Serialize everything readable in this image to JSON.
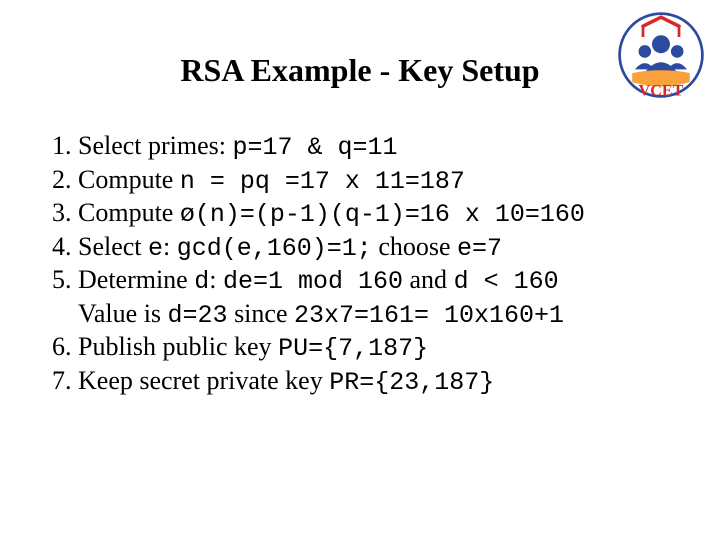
{
  "title": "RSA Example - Key Setup",
  "logo": {
    "name": "VCET",
    "colors": {
      "red": "#d62828",
      "blue": "#2b4aa0",
      "orange": "#f9a13a"
    }
  },
  "steps": [
    {
      "pre": "Select primes: ",
      "code": "p=17 & q=11"
    },
    {
      "pre": "Compute ",
      "code": "n = pq =17 x 11=187"
    },
    {
      "pre": "Compute ",
      "code": "ø(n)=(p-1)(q-1)=16 x 10=160"
    },
    {
      "pre": "Select ",
      "code_a": "e",
      "mid": ": ",
      "code_b": "gcd(e,160)=1;",
      "mid2": " choose ",
      "code_c": "e=7"
    },
    {
      "pre": "Determine ",
      "code_a": "d",
      "mid": ": ",
      "code_b": "de=1 mod 160",
      "mid2": " and ",
      "code_c": "d < 160",
      "line2_pre": "Value is ",
      "line2_code_a": "d=23",
      "line2_mid": " since ",
      "line2_code_b": "23x7=161= 10x160+1"
    },
    {
      "pre": "Publish public key ",
      "code": "PU={7,187}"
    },
    {
      "pre": "Keep secret private key ",
      "code": "PR={23,187}"
    }
  ]
}
